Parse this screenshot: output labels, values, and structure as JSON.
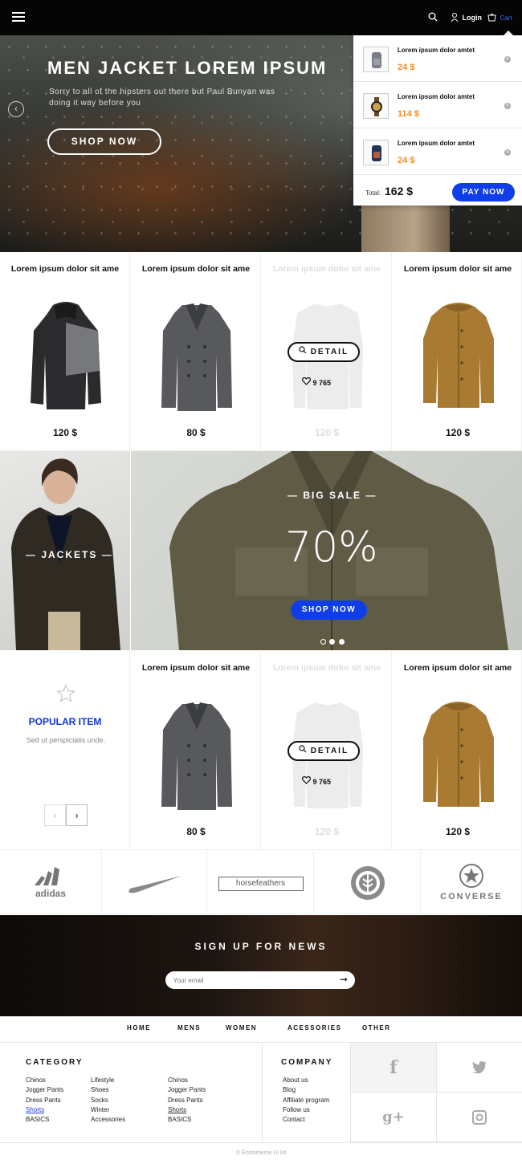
{
  "topbar": {
    "login_label": "Login",
    "cart_label": "Cart",
    "search_icon": "search-icon",
    "user_icon": "user-icon",
    "cart_icon": "cart-icon",
    "menu_icon": "menu-icon"
  },
  "hero": {
    "title": "MEN JACKET LOREM IPSUM",
    "subtitle": "Sorry to all of the hipsters out there but Paul Bunyan was doing it way before you",
    "button": "SHOP NOW"
  },
  "cart": {
    "items": [
      {
        "name": "Lorem ipsum dolor amtet",
        "price": "24 $",
        "icon": "backpack-icon"
      },
      {
        "name": "Lorem ipsum dolor amtet",
        "price": "114 $",
        "icon": "watch-icon"
      },
      {
        "name": "Lorem ipsum dolor amtet",
        "price": "24 $",
        "icon": "backpack-icon"
      }
    ],
    "total_label": "Total:",
    "total_value": "162 $",
    "pay_button": "PAY NOW"
  },
  "products_row1": [
    {
      "title": "Lorem ipsum dolor sit ame",
      "price": "120 $"
    },
    {
      "title": "Lorem ipsum dolor sit ame",
      "price": "80 $"
    },
    {
      "title": "Lorem ipsum dolor sit ame",
      "price": "120 $",
      "detail": "DETAIL",
      "likes": "9 765"
    },
    {
      "title": "Lorem ipsum dolor sit ame",
      "price": "120 $"
    }
  ],
  "banners": {
    "jackets_label": "JACKETS",
    "sale_label": "BIG SALE",
    "sale_percent": "70%",
    "sale_button": "SHOP NOW"
  },
  "popular": {
    "title": "POPULAR ITEM",
    "subtitle": "Sed ut perspiciatis unde."
  },
  "products_row2": [
    {
      "title": "Lorem ipsum dolor sit ame",
      "price": "80 $"
    },
    {
      "title": "Lorem ipsum dolor sit ame",
      "price": "120 $",
      "detail": "DETAIL",
      "likes": "9 765"
    },
    {
      "title": "Lorem ipsum dolor sit ame",
      "price": "120 $"
    }
  ],
  "brands": [
    "adidas",
    "nike",
    "horsefeathers",
    "element",
    "CONVERSE"
  ],
  "newsletter": {
    "title": "SIGN UP FOR NEWS",
    "placeholder": "Your email"
  },
  "footer_nav": [
    "HOME",
    "MENS",
    "WOMEN",
    "ACESSORIES",
    "OTHER"
  ],
  "footer": {
    "category_title": "CATEGORY",
    "cat_col1": [
      "Chinos",
      "Jogger Pants",
      "Dress Pants",
      "Shorts",
      "BASICS"
    ],
    "cat_col2": [
      "Lifestyle",
      "Shoes",
      "Socks",
      "Winter",
      "Accessories"
    ],
    "cat_col3": [
      "Chinos",
      "Jogger Pants",
      "Dress Pants",
      "Shorts",
      "BASICS"
    ],
    "company_title": "COMPANY",
    "company_links": [
      "About us",
      "Blog",
      "Affiliate program",
      "Follow us",
      "Contact"
    ],
    "copyright": "© Ecommerce UI kit"
  },
  "colors": {
    "accent": "#0f3ee8",
    "price_orange": "#f28c1f",
    "popular_blue": "#1233d4"
  }
}
